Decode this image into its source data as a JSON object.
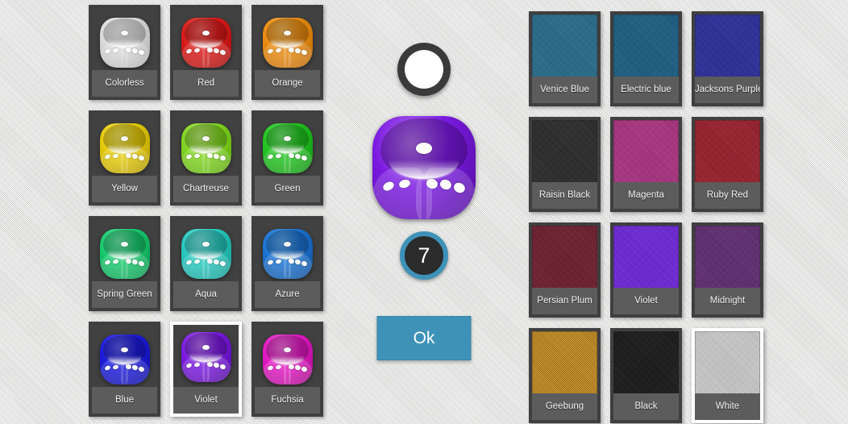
{
  "screen": {
    "name": "dice-and-table-customization",
    "background_color": "#e8e8e6"
  },
  "dice_colors": {
    "panel_name": "dice-color-palette",
    "selected": "Violet",
    "items": [
      {
        "label": "Colorless",
        "color": "#d8d8d8",
        "dark": "#a9a9a9",
        "light": "#f4f4f4"
      },
      {
        "label": "Red",
        "color": "#d81a18",
        "dark": "#9d0f0e",
        "light": "#f4625f"
      },
      {
        "label": "Orange",
        "color": "#e88a10",
        "dark": "#b3650a",
        "light": "#f7bb5a"
      },
      {
        "label": "Yellow",
        "color": "#e3c90a",
        "dark": "#a89300",
        "light": "#f6e95e"
      },
      {
        "label": "Chartreuse",
        "color": "#7fd321",
        "dark": "#5ba30f",
        "light": "#bdee75"
      },
      {
        "label": "Green",
        "color": "#22c220",
        "dark": "#118a11",
        "light": "#70e86f"
      },
      {
        "label": "Spring Green",
        "color": "#17c86c",
        "dark": "#0c8f4b",
        "light": "#6cebab"
      },
      {
        "label": "Aqua",
        "color": "#28c7bd",
        "dark": "#12938c",
        "light": "#79eae3"
      },
      {
        "label": "Azure",
        "color": "#1b72cf",
        "dark": "#0f4c93",
        "light": "#5aa7ef"
      },
      {
        "label": "Blue",
        "color": "#1b1ad8",
        "dark": "#0f0f9c",
        "light": "#5d5cf0"
      },
      {
        "label": "Violet",
        "color": "#7a19e0",
        "dark": "#4e0d96",
        "light": "#b46ef2"
      },
      {
        "label": "Fuchsia",
        "color": "#e018c0",
        "dark": "#9c0d84",
        "light": "#f26ee0"
      }
    ]
  },
  "felt_colors": {
    "panel_name": "table-felt-palette",
    "selected": "White",
    "items": [
      {
        "label": "Venice Blue",
        "color": "#1a6b8f"
      },
      {
        "label": "Electric blue",
        "color": "#0d5a85"
      },
      {
        "label": "Jacksons Purple",
        "color": "#1f23a0"
      },
      {
        "label": "Raisin Black",
        "color": "#1e1e20"
      },
      {
        "label": "Magenta",
        "color": "#b32882"
      },
      {
        "label": "Ruby Red",
        "color": "#9e121f"
      },
      {
        "label": "Persian Plum",
        "color": "#6d0f22"
      },
      {
        "label": "Violet",
        "color": "#6d1ae8"
      },
      {
        "label": "Midnight",
        "color": "#5c2071"
      },
      {
        "label": "Geebung",
        "color": "#c98a14"
      },
      {
        "label": "Black",
        "color": "#0a0a0a"
      },
      {
        "label": "White",
        "color": "#d8d8d8"
      }
    ]
  },
  "center": {
    "pip_color_button": {
      "name": "pip-color-button",
      "swatch_color": "#ffffff",
      "ring_color": "#3a3a3a"
    },
    "die_preview": {
      "name": "die-preview",
      "color": "#7a19e0",
      "dark": "#4e0d96",
      "light": "#b46ef2",
      "pip_color": "#fdfdfd"
    },
    "dice_count_badge": {
      "name": "dice-count-badge",
      "value": "7",
      "ring_color": "#3e92b8",
      "fill_color": "#2b2b2b"
    },
    "ok_button": {
      "name": "ok-button",
      "label": "Ok",
      "color": "#3e92b8"
    }
  }
}
